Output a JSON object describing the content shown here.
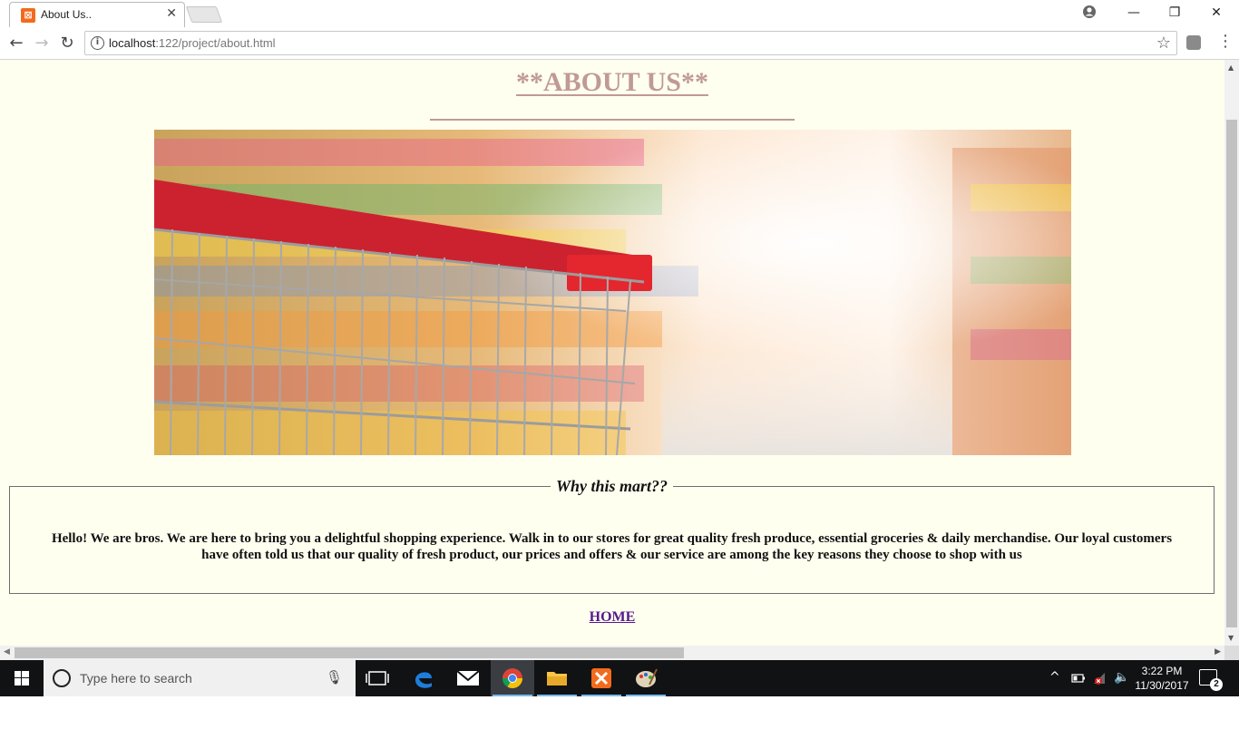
{
  "browser": {
    "tab_title": "About Us..",
    "url_host": "localhost",
    "url_rest": ":122/project/about.html"
  },
  "page": {
    "heading": "**ABOUT US**",
    "hero_image": "shopping-cart-in-supermarket-aisle",
    "section_legend": "Why this mart??",
    "section_text": "Hello! We are bros. We are here to bring you a delightful shopping experience. Walk in to our stores for great quality fresh produce, essential groceries & daily merchandise. Our loyal customers have often told us that our quality of fresh product, our prices and offers & our service are among the key reasons they choose to shop with us",
    "home_link": "HOME",
    "colors": {
      "background": "#fffff0",
      "heading": "#c09a94",
      "link": "#551a8b"
    }
  },
  "taskbar": {
    "search_placeholder": "Type here to search",
    "time": "3:22 PM",
    "date": "11/30/2017",
    "notification_count": "2",
    "pinned_apps": [
      "task-view",
      "edge",
      "mail",
      "chrome",
      "file-explorer",
      "xampp",
      "paint"
    ]
  }
}
